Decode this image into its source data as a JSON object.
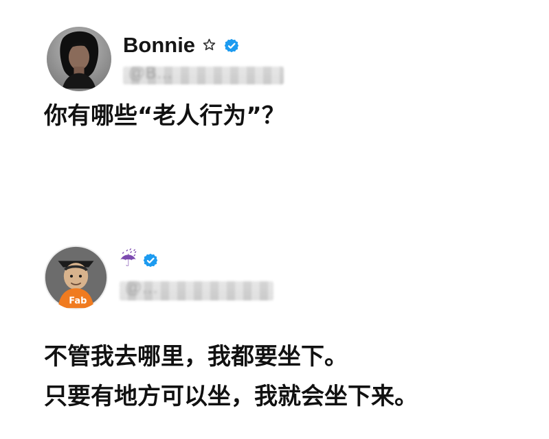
{
  "posts": [
    {
      "display_name": "Bonnie",
      "name_badges": {
        "star_icon": "star-outline-icon",
        "verified_icon": "verified-badge-icon"
      },
      "handle": "@B…",
      "text": "你有哪些“老人行为”？"
    },
    {
      "display_name": "☔",
      "name_badges": {
        "verified_icon": "verified-badge-icon"
      },
      "handle": "@…",
      "text_lines": [
        "不管我去哪里，我都要坐下。",
        "只要有地方可以坐，我就会坐下来。"
      ]
    }
  ],
  "colors": {
    "background": "#ffffff",
    "text": "#111111",
    "verified": "#1d9bf0"
  }
}
